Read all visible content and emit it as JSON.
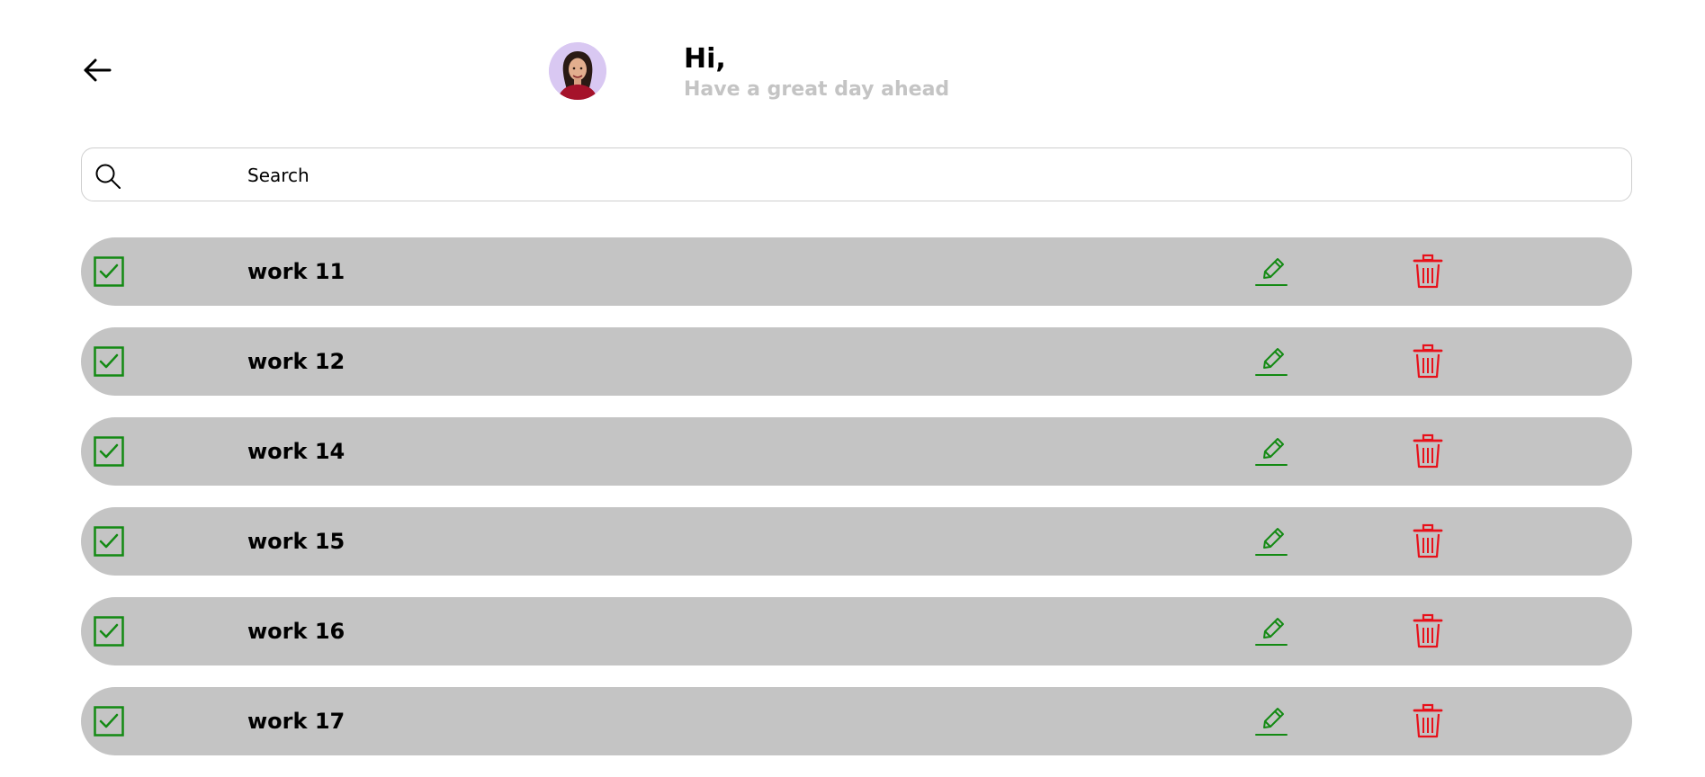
{
  "header": {
    "back_icon": "arrow-left-icon",
    "avatar_icon": "user-avatar",
    "greeting_title": "Hi,",
    "greeting_subtitle": "Have a great day ahead"
  },
  "search": {
    "icon": "search-icon",
    "placeholder": "Search",
    "value": ""
  },
  "tasks": [
    {
      "title": "work 11",
      "completed": true
    },
    {
      "title": "work 12",
      "completed": true
    },
    {
      "title": "work 14",
      "completed": true
    },
    {
      "title": "work 15",
      "completed": true
    },
    {
      "title": "work 16",
      "completed": true
    },
    {
      "title": "work 17",
      "completed": true
    }
  ],
  "colors": {
    "task_row_bg": "#c4c4c4",
    "check_color": "#138a13",
    "edit_color": "#138a13",
    "delete_color": "#e8101a",
    "subtitle_color": "#c4c4c4",
    "avatar_bg": "#d9c8f2"
  },
  "icons": {
    "check": "checkbox-checked-icon",
    "edit": "pencil-icon",
    "delete": "trash-icon"
  }
}
